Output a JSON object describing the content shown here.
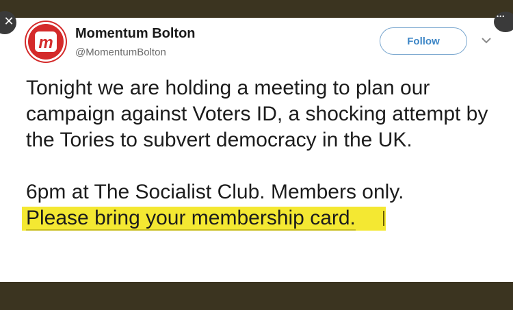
{
  "profile": {
    "display_name": "Momentum Bolton",
    "handle": "@MomentumBolton",
    "avatar_letter": "m",
    "brand_color": "#d42a2a"
  },
  "actions": {
    "follow_label": "Follow",
    "close_icon": "close-icon",
    "more_icon": "more-icon",
    "menu_icon": "chevron-down-icon",
    "follow_color": "#3d86c6"
  },
  "tweet": {
    "paragraph1": "Tonight we are holding a meeting to plan our campaign against Voters ID, a shocking attempt by the Tories to subvert democracy in the UK.",
    "paragraph2_line1": "6pm at The Socialist Club. Members only.",
    "paragraph2_highlighted": "Please bring your membership card.",
    "highlight_color": "#f4e832"
  }
}
